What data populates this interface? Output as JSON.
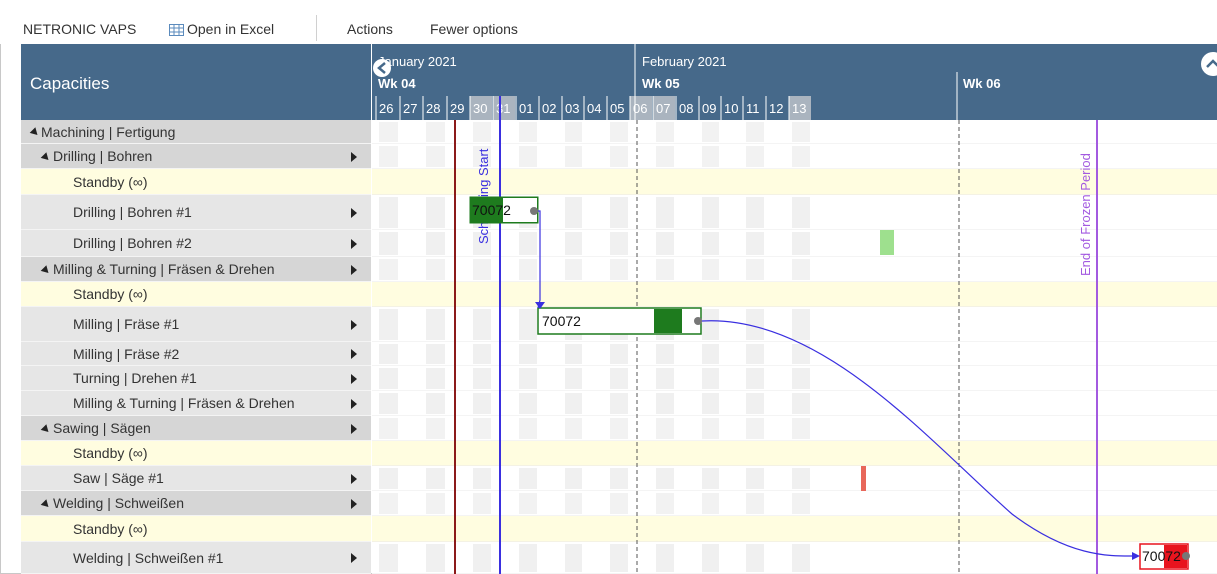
{
  "toolbar": {
    "app_name": "NETRONIC VAPS",
    "open_excel": "Open in Excel",
    "actions": "Actions",
    "fewer_options": "Fewer options"
  },
  "capacities_title": "Capacities",
  "header": {
    "months": [
      "January 2021",
      "February 2021"
    ],
    "weeks": [
      "Wk 04",
      "Wk 05",
      "Wk 06"
    ],
    "days": [
      "26",
      "27",
      "28",
      "29",
      "30",
      "31",
      "01",
      "02",
      "03",
      "04",
      "05",
      "06",
      "07",
      "08",
      "09",
      "10",
      "11",
      "12",
      "13"
    ],
    "weekend_days": [
      "30",
      "31",
      "06",
      "07",
      "13"
    ]
  },
  "rows": [
    {
      "label": "Machining | Fertigung",
      "type": "group",
      "level": 0,
      "expand": "collapse",
      "arrow": false
    },
    {
      "label": "Drilling | Bohren",
      "type": "group",
      "level": 1,
      "expand": "collapse",
      "arrow": true
    },
    {
      "label": "Standby (∞)",
      "type": "standby",
      "level": 2,
      "expand": "",
      "arrow": false
    },
    {
      "label": "Drilling | Bohren #1",
      "type": "resource",
      "level": 2,
      "expand": "",
      "arrow": true
    },
    {
      "label": "Drilling | Bohren #2",
      "type": "resource",
      "level": 2,
      "expand": "",
      "arrow": true
    },
    {
      "label": "Milling & Turning | Fräsen & Drehen",
      "type": "group",
      "level": 1,
      "expand": "collapse",
      "arrow": true
    },
    {
      "label": "Standby (∞)",
      "type": "standby",
      "level": 2,
      "expand": "",
      "arrow": false
    },
    {
      "label": "Milling | Fräse #1",
      "type": "resource",
      "level": 2,
      "expand": "",
      "arrow": true
    },
    {
      "label": "Milling | Fräse #2",
      "type": "resource",
      "level": 2,
      "expand": "",
      "arrow": true
    },
    {
      "label": "Turning | Drehen #1",
      "type": "resource",
      "level": 2,
      "expand": "",
      "arrow": true
    },
    {
      "label": "Milling & Turning | Fräsen & Drehen",
      "type": "resource",
      "level": 2,
      "expand": "",
      "arrow": true
    },
    {
      "label": "Sawing | Sägen",
      "type": "group",
      "level": 1,
      "expand": "collapse",
      "arrow": true
    },
    {
      "label": "Standby (∞)",
      "type": "standby",
      "level": 2,
      "expand": "",
      "arrow": false
    },
    {
      "label": "Saw | Säge #1",
      "type": "resource",
      "level": 2,
      "expand": "",
      "arrow": true
    },
    {
      "label": "Welding | Schweißen",
      "type": "group",
      "level": 1,
      "expand": "collapse",
      "arrow": true
    },
    {
      "label": "Standby (∞)",
      "type": "standby",
      "level": 2,
      "expand": "",
      "arrow": false
    },
    {
      "label": "Welding | Schweißen #1",
      "type": "resource",
      "level": 2,
      "expand": "",
      "arrow": true
    }
  ],
  "markers": {
    "scheduling_start": "Scheduling Start",
    "frozen_period_end": "End of Frozen Period"
  },
  "tasks": [
    {
      "label": "70072",
      "row": 3
    },
    {
      "label": "70072",
      "row": 7
    },
    {
      "label": "70072",
      "row": 16
    }
  ],
  "colors": {
    "header_bg": "#46698a",
    "task_green": "#1e7b1e",
    "task_red": "#e8141e",
    "scheduling_line": "#3a2fe0",
    "frozen_line": "#a35ae0",
    "today_line": "#8b1a1a",
    "standby_bg": "#fffde0"
  }
}
